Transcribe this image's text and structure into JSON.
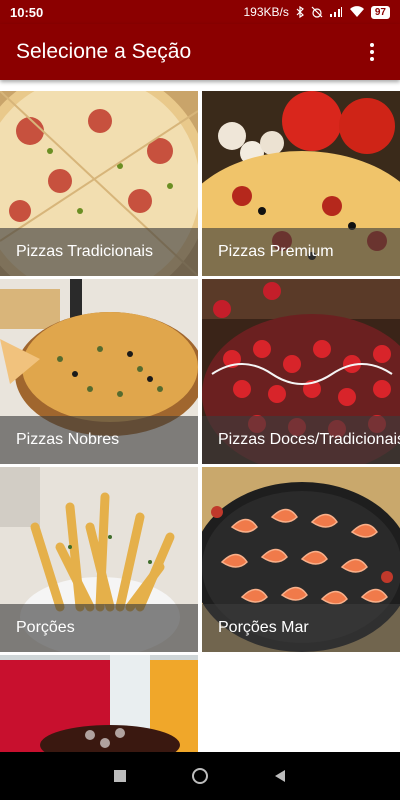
{
  "status": {
    "time": "10:50",
    "net_speed": "193KB/s",
    "battery": "97"
  },
  "app_bar": {
    "title": "Selecione a Seção",
    "menu_icon": "more-vert-icon"
  },
  "sections": [
    {
      "label": "Pizzas Tradicionais",
      "icon": "pizza-image"
    },
    {
      "label": "Pizzas Premium",
      "icon": "pizza-tomato-image"
    },
    {
      "label": "Pizzas Nobres",
      "icon": "pizza-board-image"
    },
    {
      "label": "Pizzas Doces/Tradicionais",
      "icon": "strawberry-pizza-image"
    },
    {
      "label": "Porções",
      "icon": "fries-image"
    },
    {
      "label": "Porções Mar",
      "icon": "shrimp-image"
    },
    {
      "label": "",
      "icon": "drinks-image"
    }
  ],
  "colors": {
    "primary": "#8b0000",
    "caption_overlay": "#3c3c3c"
  }
}
